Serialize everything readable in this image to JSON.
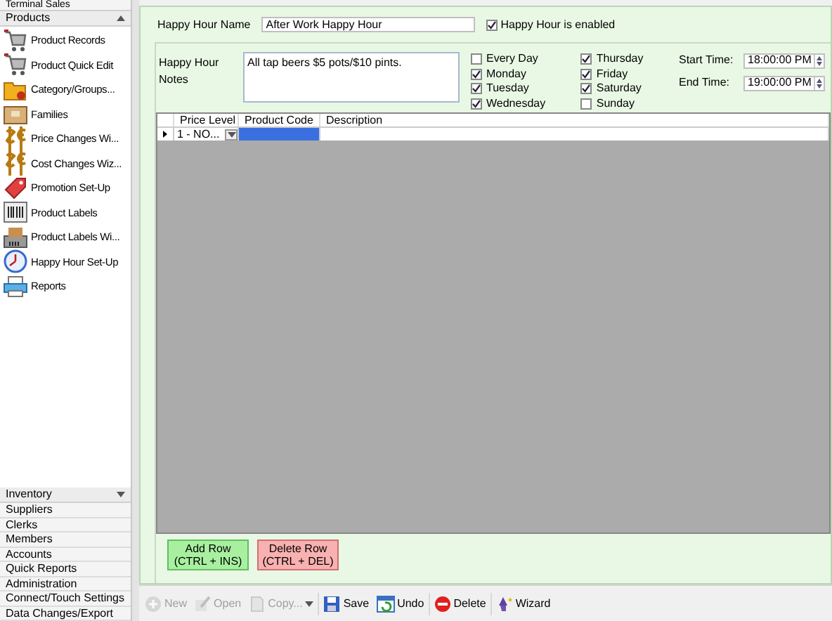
{
  "sidebar": {
    "top_group": "Terminal Sales",
    "open_group": {
      "label": "Products",
      "expanded": true
    },
    "items": [
      "Product Records",
      "Product Quick Edit",
      "Category/Groups...",
      "Families",
      "Price Changes Wi...",
      "Cost Changes Wiz...",
      "Promotion Set-Up",
      "Product Labels",
      "Product Labels Wi...",
      "Happy Hour Set-Up",
      "Reports"
    ],
    "bottom_group": {
      "label": "Inventory",
      "expanded": false
    },
    "bottom_items": [
      "Suppliers",
      "Clerks",
      "Members",
      "Accounts",
      "Quick Reports",
      "Administration",
      "Connect/Touch Settings",
      "Data Changes/Export"
    ]
  },
  "form": {
    "name_label": "Happy Hour Name",
    "name_value": "After Work Happy Hour",
    "enabled": {
      "label": "Happy Hour is enabled",
      "checked": true
    },
    "notes_label": "Happy Hour Notes",
    "notes_value": "All tap beers $5 pots/$10 pints.",
    "days": [
      {
        "label": "Every Day",
        "checked": false
      },
      {
        "label": "Monday",
        "checked": true
      },
      {
        "label": "Tuesday",
        "checked": true
      },
      {
        "label": "Wednesday",
        "checked": true
      },
      {
        "label": "Thursday",
        "checked": true
      },
      {
        "label": "Friday",
        "checked": true
      },
      {
        "label": "Saturday",
        "checked": true
      },
      {
        "label": "Sunday",
        "checked": false
      }
    ],
    "start_label": "Start Time:",
    "start_value": "18:00:00 PM",
    "end_label": "End Time:",
    "end_value": "19:00:00 PM"
  },
  "table": {
    "columns": [
      "Price Level",
      "Product Code",
      "Description"
    ],
    "rows": [
      {
        "cells": [
          {
            "text": "1 - NO...",
            "selected": false
          },
          {
            "selected": true
          },
          {
            "selected": false
          }
        ]
      }
    ]
  },
  "grid_buttons": [
    {
      "label": "Add Row (CTRL + INS)",
      "kind": "add"
    },
    {
      "label": "Delete Row (CTRL + DEL)",
      "kind": "delete"
    }
  ],
  "toolbar": [
    {
      "label": "New",
      "disabled": true
    },
    {
      "label": "Open",
      "disabled": true
    },
    {
      "label": "Copy...",
      "disabled": true,
      "dropdown": true
    },
    {
      "label": "Save",
      "disabled": false
    },
    {
      "label": "Undo",
      "disabled": false
    },
    {
      "label": "Delete",
      "disabled": false
    },
    {
      "label": "Wizard",
      "disabled": false
    }
  ]
}
